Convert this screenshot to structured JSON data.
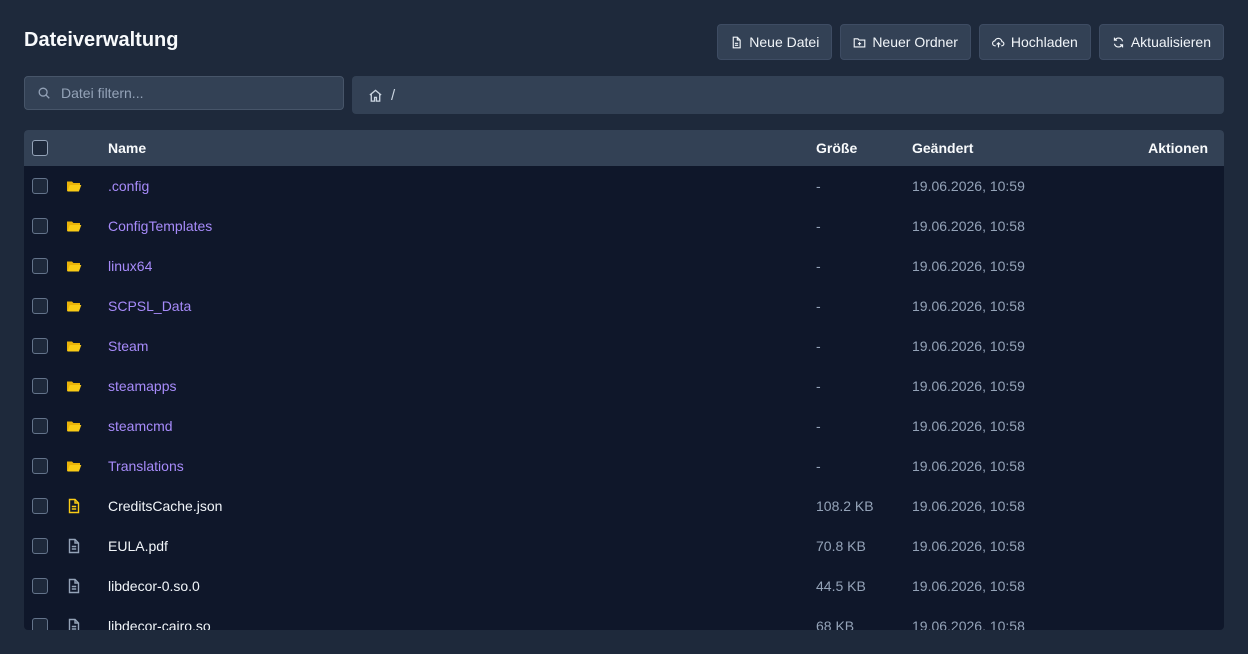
{
  "header": {
    "title": "Dateiverwaltung",
    "buttons": {
      "new_file": "Neue Datei",
      "new_folder": "Neuer Ordner",
      "upload": "Hochladen",
      "refresh": "Aktualisieren"
    }
  },
  "filter": {
    "placeholder": "Datei filtern...",
    "value": ""
  },
  "breadcrumb": {
    "path": "/"
  },
  "table": {
    "columns": {
      "name": "Name",
      "size": "Größe",
      "modified": "Geändert",
      "actions": "Aktionen"
    },
    "rows": [
      {
        "type": "folder",
        "name": ".config",
        "size": "-",
        "modified": "19.06.2026, 10:59"
      },
      {
        "type": "folder",
        "name": "ConfigTemplates",
        "size": "-",
        "modified": "19.06.2026, 10:58"
      },
      {
        "type": "folder",
        "name": "linux64",
        "size": "-",
        "modified": "19.06.2026, 10:59"
      },
      {
        "type": "folder",
        "name": "SCPSL_Data",
        "size": "-",
        "modified": "19.06.2026, 10:58"
      },
      {
        "type": "folder",
        "name": "Steam",
        "size": "-",
        "modified": "19.06.2026, 10:59"
      },
      {
        "type": "folder",
        "name": "steamapps",
        "size": "-",
        "modified": "19.06.2026, 10:59"
      },
      {
        "type": "folder",
        "name": "steamcmd",
        "size": "-",
        "modified": "19.06.2026, 10:58"
      },
      {
        "type": "folder",
        "name": "Translations",
        "size": "-",
        "modified": "19.06.2026, 10:58"
      },
      {
        "type": "json",
        "name": "CreditsCache.json",
        "size": "108.2 KB",
        "modified": "19.06.2026, 10:58"
      },
      {
        "type": "file",
        "name": "EULA.pdf",
        "size": "70.8 KB",
        "modified": "19.06.2026, 10:58"
      },
      {
        "type": "file",
        "name": "libdecor-0.so.0",
        "size": "44.5 KB",
        "modified": "19.06.2026, 10:58"
      },
      {
        "type": "file",
        "name": "libdecor-cairo.so",
        "size": "68 KB",
        "modified": "19.06.2026, 10:58"
      }
    ]
  },
  "colors": {
    "background": "#1e293b",
    "table_body": "#0f172a",
    "header_row": "#334155",
    "folder_name": "#a78bfa",
    "folder_icon": "#facc15",
    "json_icon": "#facc15",
    "file_icon": "#94a3b8"
  }
}
